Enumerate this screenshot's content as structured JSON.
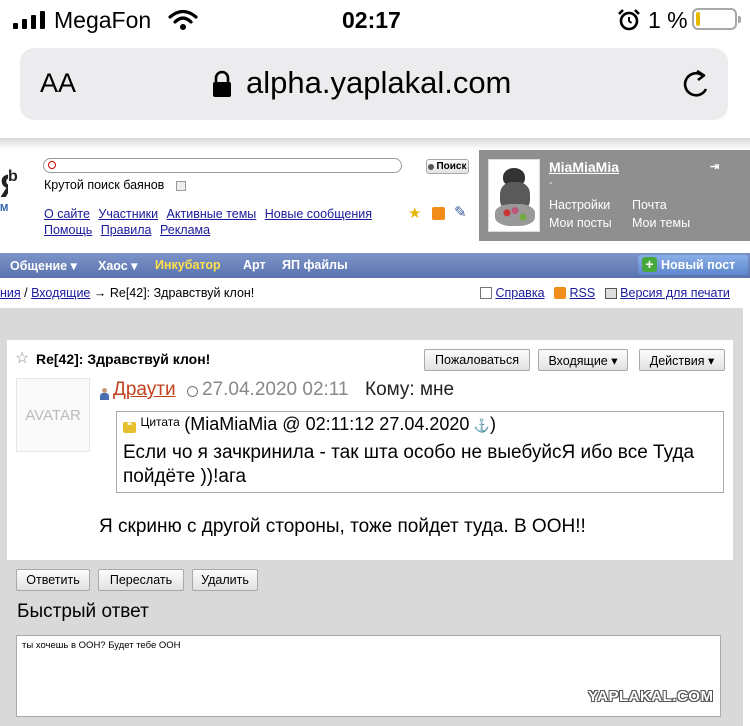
{
  "status_bar": {
    "carrier": "MegaFon",
    "time": "02:17",
    "battery": "1 %"
  },
  "browser": {
    "text_size": "AA",
    "url": "alpha.yaplakal.com"
  },
  "header": {
    "logo_fragment": "b",
    "logo_fragment2": "M",
    "search_button": "Поиск",
    "search_hint": "Крутой поиск баянов",
    "links_row1": [
      "О сайте",
      "Участники",
      "Активные темы",
      "Новые сообщения"
    ],
    "links_row2": [
      "Помощь",
      "Правила",
      "Реклама"
    ]
  },
  "user_panel": {
    "username": "MiaMiaMia",
    "subtitle": "-",
    "settings": "Настройки",
    "mail": "Почта",
    "my_posts": "Мои посты",
    "my_topics": "Мои темы"
  },
  "nav": {
    "items": [
      "Общение ▾",
      "Хаос ▾",
      "Инкубатор",
      "Арт",
      "ЯП файлы"
    ],
    "new_post": "Новый пост"
  },
  "breadcrumb": {
    "part1": "ния",
    "sep1": "/",
    "part2": "Входящие",
    "arrow": "→",
    "current": "Re[42]: Здравствуй клон!"
  },
  "page_tools": {
    "help": "Справка",
    "rss": "RSS",
    "print": "Версия для печати"
  },
  "message": {
    "title": "Re[42]: Здравствуй клон!",
    "complain": "Пожаловаться",
    "inbox": "Входящие ▾",
    "actions": "Действия ▾",
    "avatar": "AVATAR",
    "author": "Драути",
    "date": "27.04.2020 02:11",
    "to": "Кому: мне",
    "quote_label": "Цитата",
    "quote_meta": "(MiaMiaMia @ 02:11:12 27.04.2020",
    "quote_end": ")",
    "quote_text": "Если чо я зачкринила - так шта особо не выебуйсЯ ибо все Туда пойдёте ))!ага",
    "body": "Я скриню с другой стороны, тоже пойдет туда. В ООН!!"
  },
  "reply_buttons": {
    "reply": "Ответить",
    "forward": "Переслать",
    "delete": "Удалить"
  },
  "quick_reply": {
    "heading": "Быстрый ответ",
    "text": "ты хочешь в ООН? Будет тебе ООН"
  },
  "watermark": "YAPLAKAL.COM"
}
